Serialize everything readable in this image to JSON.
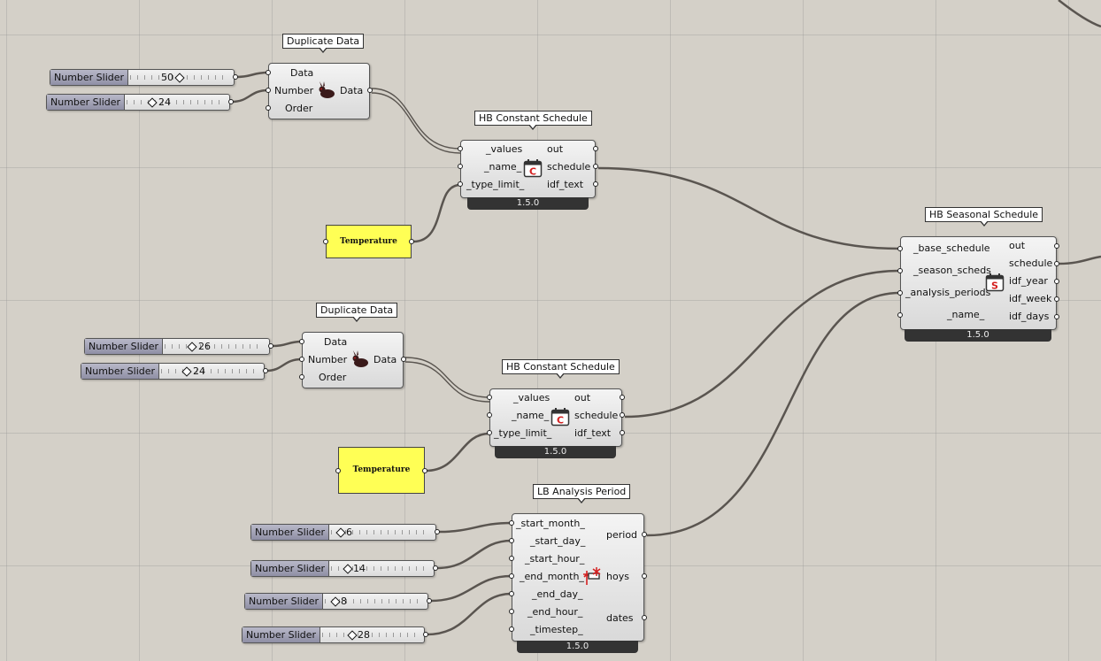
{
  "components": {
    "dup1": {
      "title": "Duplicate Data",
      "inputs": [
        "Data",
        "Number",
        "Order"
      ],
      "output": "Data"
    },
    "dup2": {
      "title": "Duplicate Data",
      "inputs": [
        "Data",
        "Number",
        "Order"
      ],
      "output": "Data"
    },
    "hbc1": {
      "title": "HB Constant Schedule",
      "inputs": [
        "_values",
        "_name_",
        "_type_limit_"
      ],
      "outputs": [
        "out",
        "schedule",
        "idf_text"
      ],
      "version": "1.5.0"
    },
    "hbc2": {
      "title": "HB Constant Schedule",
      "inputs": [
        "_values",
        "_name_",
        "_type_limit_"
      ],
      "outputs": [
        "out",
        "schedule",
        "idf_text"
      ],
      "version": "1.5.0"
    },
    "hbs": {
      "title": "HB Seasonal Schedule",
      "inputs": [
        "_base_schedule",
        "_season_scheds",
        "_analysis_periods",
        "_name_"
      ],
      "outputs": [
        "out",
        "schedule",
        "idf_year",
        "idf_week",
        "idf_days"
      ],
      "version": "1.5.0"
    },
    "lbp": {
      "title": "LB Analysis Period",
      "inputs": [
        "_start_month_",
        "_start_day_",
        "_start_hour_",
        "_end_month_",
        "_end_day_",
        "_end_hour_",
        "_timestep_"
      ],
      "outputs": [
        "period",
        "hoys",
        "dates"
      ],
      "version": "1.5.0"
    }
  },
  "sliders": [
    {
      "name": "Number Slider",
      "value": "50"
    },
    {
      "name": "Number Slider",
      "value": "24"
    },
    {
      "name": "Number Slider",
      "value": "26"
    },
    {
      "name": "Number Slider",
      "value": "24"
    },
    {
      "name": "Number Slider",
      "value": "6"
    },
    {
      "name": "Number Slider",
      "value": "14"
    },
    {
      "name": "Number Slider",
      "value": "8"
    },
    {
      "name": "Number Slider",
      "value": "28"
    }
  ],
  "panels": [
    {
      "text": "Temperature"
    },
    {
      "text": "Temperature"
    }
  ],
  "icons": {
    "duplicate": "rabbit-icon",
    "constant": "calendar-c-icon",
    "seasonal": "calendar-s-icon",
    "period": "analysis-period-icon"
  },
  "colors": {
    "canvas": "#d4d0c8",
    "panel": "#ffff55",
    "wire": "#5a5550",
    "icon_red": "#d42020"
  }
}
